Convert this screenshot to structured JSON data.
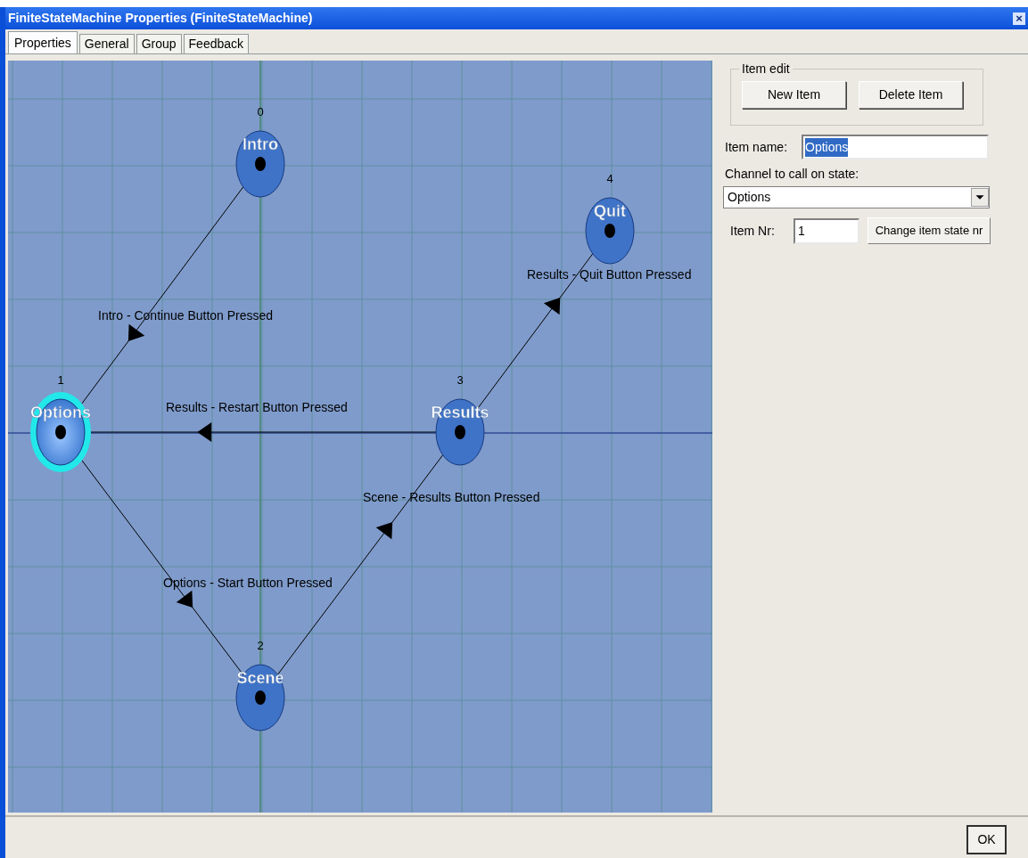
{
  "window": {
    "title": "FiniteStateMachine Properties (FiniteStateMachine)",
    "close": "×"
  },
  "tabs": [
    {
      "label": "Properties",
      "selected": true
    },
    {
      "label": "General",
      "selected": false
    },
    {
      "label": "Group",
      "selected": false
    },
    {
      "label": "Feedback",
      "selected": false
    }
  ],
  "diagram": {
    "nodes": [
      {
        "number": "0",
        "name": "Intro",
        "selected": false
      },
      {
        "number": "1",
        "name": "Options",
        "selected": true
      },
      {
        "number": "2",
        "name": "Scene",
        "selected": false
      },
      {
        "number": "3",
        "name": "Results",
        "selected": false
      },
      {
        "number": "4",
        "name": "Quit",
        "selected": false
      }
    ],
    "edges": [
      {
        "label": "Intro - Continue Button Pressed"
      },
      {
        "label": "Results - Restart Button Pressed"
      },
      {
        "label": "Options - Start Button Pressed"
      },
      {
        "label": "Scene - Results Button Pressed"
      },
      {
        "label": "Results - Quit Button Pressed"
      }
    ]
  },
  "item_edit": {
    "title": "Item edit",
    "buttons": [
      "New Item",
      "Delete Item"
    ]
  },
  "item_name": {
    "label": "Item name:",
    "value": "Options"
  },
  "channel": {
    "label": "Channel to call on state:",
    "value": "Options"
  },
  "item_nr": {
    "label": "Item Nr:",
    "value": "1",
    "button": "Change item state nr"
  },
  "ok_button": "OK"
}
